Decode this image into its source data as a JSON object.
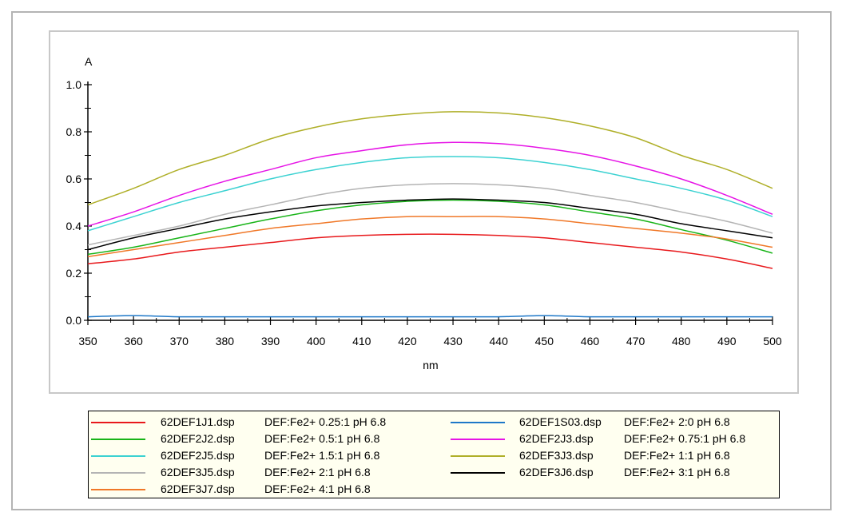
{
  "chart_data": {
    "type": "line",
    "title": "",
    "xlabel": "nm",
    "ylabel": "A",
    "xlim": [
      350,
      500
    ],
    "ylim": [
      0,
      1.0
    ],
    "x_ticks": [
      "350",
      "360",
      "370",
      "380",
      "390",
      "400",
      "410",
      "420",
      "430",
      "440",
      "450",
      "460",
      "470",
      "480",
      "490",
      "500"
    ],
    "y_ticks": [
      "0.0",
      "0.2",
      "0.4",
      "0.6",
      "0.8",
      "1.0"
    ],
    "x": [
      350,
      360,
      370,
      380,
      390,
      400,
      410,
      420,
      430,
      440,
      450,
      460,
      470,
      480,
      490,
      500
    ],
    "legend_position": "bottom",
    "series": [
      {
        "name": "62DEF1J1.dsp",
        "description": "DEF:Fe2+ 0.25:1 pH 6.8",
        "color": "#e8191c",
        "values": [
          0.24,
          0.26,
          0.29,
          0.31,
          0.33,
          0.35,
          0.36,
          0.365,
          0.365,
          0.36,
          0.35,
          0.33,
          0.31,
          0.29,
          0.26,
          0.22
        ]
      },
      {
        "name": "62DEF2J2.dsp",
        "description": "DEF:Fe2+ 0.5:1 pH 6.8",
        "color": "#18b418",
        "values": [
          0.28,
          0.31,
          0.35,
          0.39,
          0.43,
          0.465,
          0.49,
          0.505,
          0.51,
          0.505,
          0.49,
          0.46,
          0.43,
          0.385,
          0.34,
          0.285
        ]
      },
      {
        "name": "62DEF2J5.dsp",
        "description": "DEF:Fe2+ 1.5:1 pH 6.8",
        "color": "#3cd2d2",
        "values": [
          0.38,
          0.44,
          0.5,
          0.55,
          0.6,
          0.64,
          0.67,
          0.69,
          0.695,
          0.69,
          0.67,
          0.64,
          0.6,
          0.56,
          0.51,
          0.44
        ]
      },
      {
        "name": "62DEF3J5.dsp",
        "description": "DEF:Fe2+ 2:1 pH 6.8",
        "color": "#b4b4b4",
        "values": [
          0.32,
          0.36,
          0.4,
          0.45,
          0.49,
          0.53,
          0.56,
          0.575,
          0.58,
          0.575,
          0.56,
          0.53,
          0.5,
          0.46,
          0.42,
          0.37
        ]
      },
      {
        "name": "62DEF3J7.dsp",
        "description": "DEF:Fe2+ 4:1 pH 6.8",
        "color": "#f07828",
        "values": [
          0.27,
          0.3,
          0.33,
          0.36,
          0.39,
          0.41,
          0.43,
          0.44,
          0.44,
          0.44,
          0.43,
          0.41,
          0.39,
          0.37,
          0.345,
          0.31
        ]
      },
      {
        "name": "62DEF1S03.dsp",
        "description": "DEF:Fe2+ 2:0 pH 6.8",
        "color": "#1e78c8",
        "values": [
          0.015,
          0.02,
          0.015,
          0.015,
          0.015,
          0.015,
          0.015,
          0.015,
          0.015,
          0.015,
          0.02,
          0.015,
          0.015,
          0.015,
          0.015,
          0.015
        ]
      },
      {
        "name": "62DEF2J3.dsp",
        "description": "DEF:Fe2+ 0.75:1 pH 6.8",
        "color": "#e614e6",
        "values": [
          0.4,
          0.46,
          0.53,
          0.59,
          0.64,
          0.69,
          0.72,
          0.745,
          0.755,
          0.75,
          0.73,
          0.7,
          0.655,
          0.6,
          0.53,
          0.45
        ]
      },
      {
        "name": "62DEF3J3.dsp",
        "description": "DEF:Fe2+ 1:1 pH 6.8",
        "color": "#afaf28",
        "values": [
          0.49,
          0.56,
          0.64,
          0.7,
          0.77,
          0.82,
          0.855,
          0.875,
          0.885,
          0.88,
          0.86,
          0.825,
          0.775,
          0.7,
          0.64,
          0.56
        ]
      },
      {
        "name": "62DEF3J6.dsp",
        "description": "DEF:Fe2+ 3:1 pH 6.8",
        "color": "#000000",
        "values": [
          0.3,
          0.35,
          0.39,
          0.43,
          0.46,
          0.485,
          0.5,
          0.51,
          0.515,
          0.51,
          0.5,
          0.475,
          0.45,
          0.41,
          0.38,
          0.35
        ]
      }
    ]
  }
}
